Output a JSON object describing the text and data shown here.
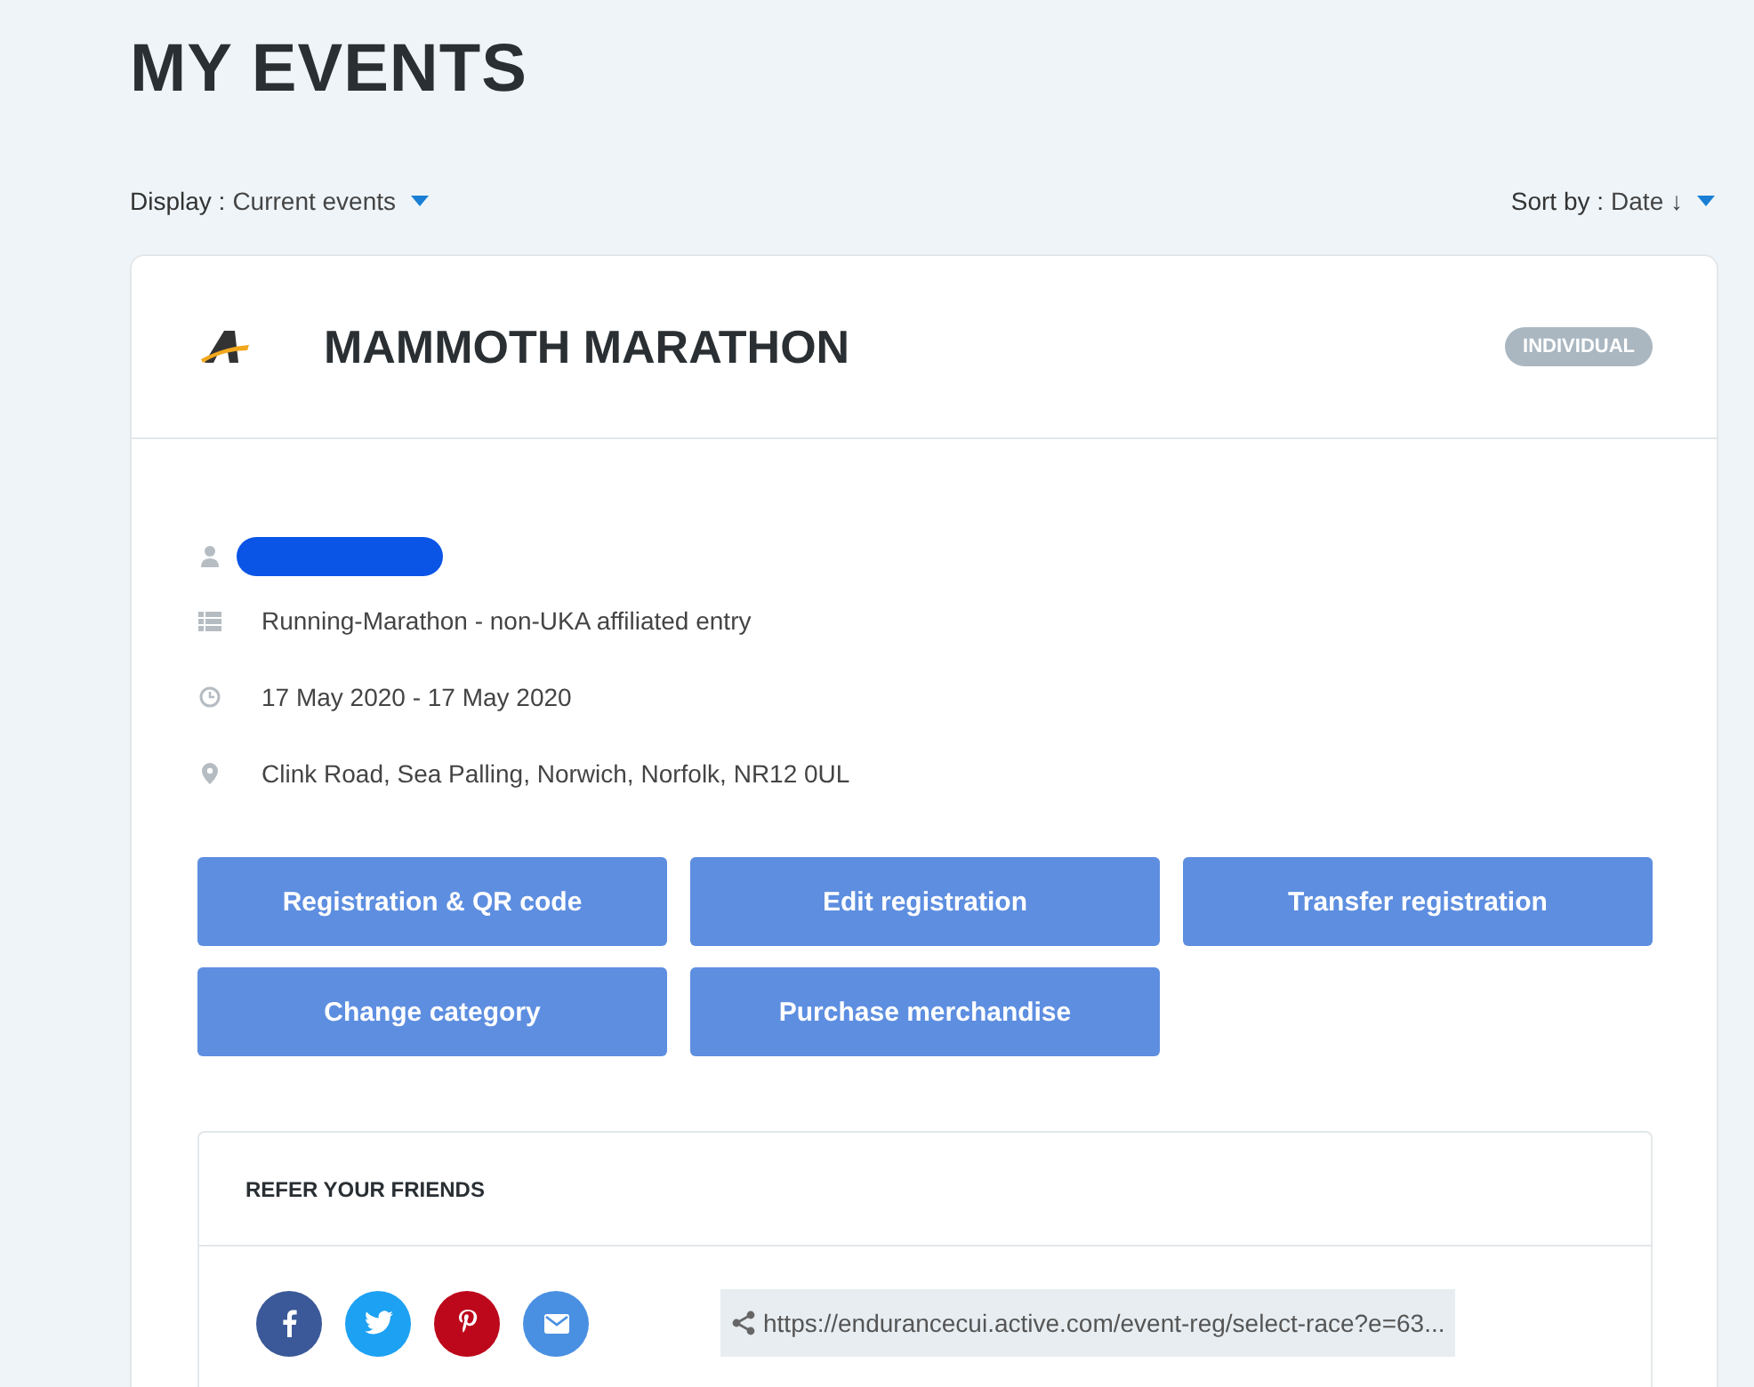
{
  "page_title": "MY EVENTS",
  "display": {
    "label": "Display :",
    "value": "Current events"
  },
  "sort": {
    "label": "Sort by :",
    "value": "Date ↓"
  },
  "event": {
    "title": "MAMMOTH MARATHON",
    "badge": "INDIVIDUAL",
    "details": [
      {
        "kind": "person",
        "redacted": true
      },
      {
        "kind": "category",
        "text": "Running-Marathon - non-UKA affiliated entry",
        "redacted": false
      },
      {
        "kind": "date",
        "text": "17 May 2020 - 17 May 2020",
        "redacted": false
      },
      {
        "kind": "location",
        "text": "Clink Road, Sea Palling, Norwich, Norfolk, NR12 0UL",
        "redacted": false
      }
    ],
    "actions": [
      "Registration & QR code",
      "Edit registration",
      "Transfer registration",
      "Change category",
      "Purchase merchandise"
    ],
    "refer": {
      "title": "REFER YOUR FRIENDS",
      "social": [
        {
          "kind": "facebook",
          "color": "#3b5998"
        },
        {
          "kind": "twitter",
          "color": "#1da1f2"
        },
        {
          "kind": "pinterest",
          "color": "#bd081c"
        },
        {
          "kind": "email",
          "color": "#4a90e2"
        }
      ],
      "link": "https://endurancecui.active.com/event-reg/select-race?e=63..."
    }
  }
}
